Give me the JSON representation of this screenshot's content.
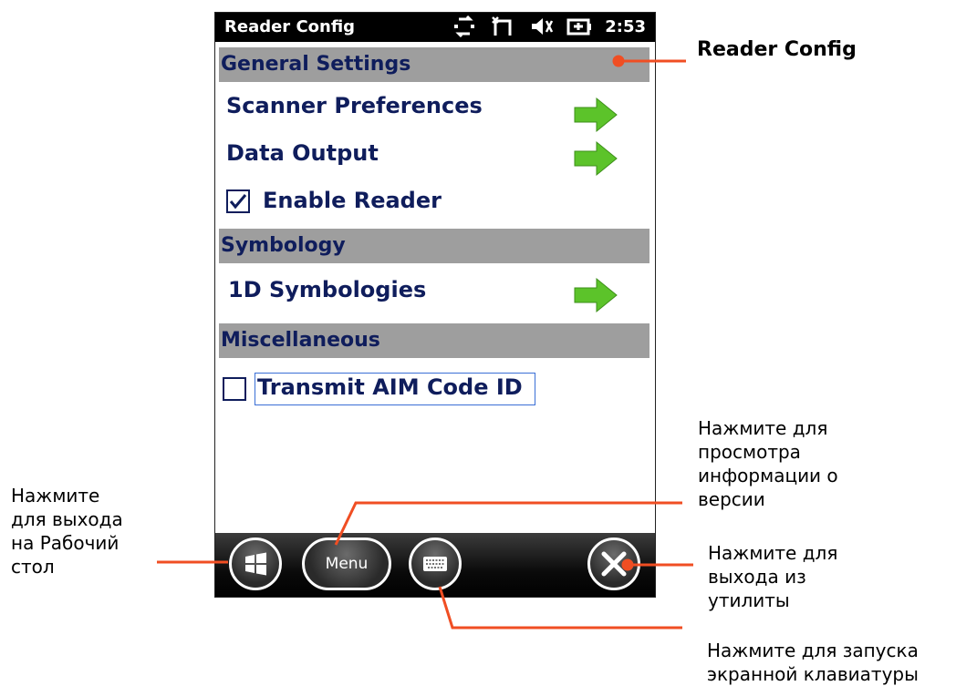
{
  "status_bar": {
    "title": "Reader Config",
    "time": "2:53",
    "icons": [
      "connectivity-arrows-icon",
      "signal-x-icon",
      "speaker-muted-icon",
      "battery-charging-icon"
    ]
  },
  "sections": {
    "general": "General Settings",
    "symbology": "Symbology",
    "misc": "Miscellaneous"
  },
  "items": {
    "scanner_prefs": "Scanner Preferences",
    "data_output": "Data Output",
    "enable_reader": "Enable Reader",
    "symbologies_1d": "1D Symbologies",
    "transmit_aim": "Transmit AIM Code ID"
  },
  "checkboxes": {
    "enable_reader": true,
    "transmit_aim": false
  },
  "bottom_bar": {
    "menu_label": "Menu"
  },
  "annotations": {
    "title_callout": "Reader Config",
    "desktop": [
      "Нажмите",
      "для выхода",
      "на Рабочий",
      "стол"
    ],
    "version": [
      "Нажмите для",
      "просмотра",
      "информации о",
      "версии"
    ],
    "exit": [
      "Нажмите для",
      "выхода из",
      "утилиты"
    ],
    "keyboard": [
      "Нажмите для запуска",
      "экранной клавиатуры"
    ]
  },
  "colors": {
    "accent_arrow": "#5cc32a",
    "callout_line": "#f04e23",
    "header_gray": "#9e9e9e",
    "text_navy": "#0f1d5c"
  }
}
